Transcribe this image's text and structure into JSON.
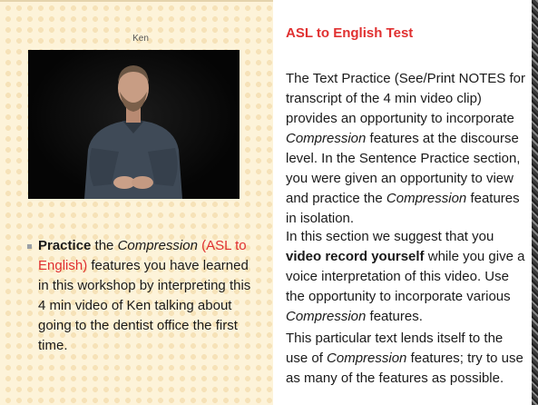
{
  "video": {
    "caption": "Ken"
  },
  "left": {
    "bullet": {
      "bold": "Practice",
      "t1": " the ",
      "em1": "Compression",
      "red": " (ASL to English)",
      "t2": " features you have learned in this workshop by interpreting this 4 min video of Ken  talking about going to the dentist office the first time."
    }
  },
  "right": {
    "heading": "ASL to English Test",
    "p1": {
      "t1": "The Text Practice (See/Print NOTES for transcript of the 4 min video clip) provides an opportunity to incorporate ",
      "em1": "Compression",
      "t2": " features at the discourse level. In the Sentence Practice section, you were given an opportunity to view and practice the ",
      "em2": "Compression",
      "t3": " features in isolation."
    },
    "p2": {
      "t1": "In this section we suggest that you ",
      "bold": "video record yourself",
      "t2": " while you give a voice interpretation of this video. Use the opportunity to incorporate various ",
      "em1": "Compression",
      "t3": " features."
    },
    "p3": {
      "t1": "This particular text lends itself to the use of ",
      "em1": "Compression",
      "t2": " features; try to use as many of the features as possible."
    }
  },
  "colors": {
    "accent": "#e03030",
    "background": "#fdf3d9"
  }
}
